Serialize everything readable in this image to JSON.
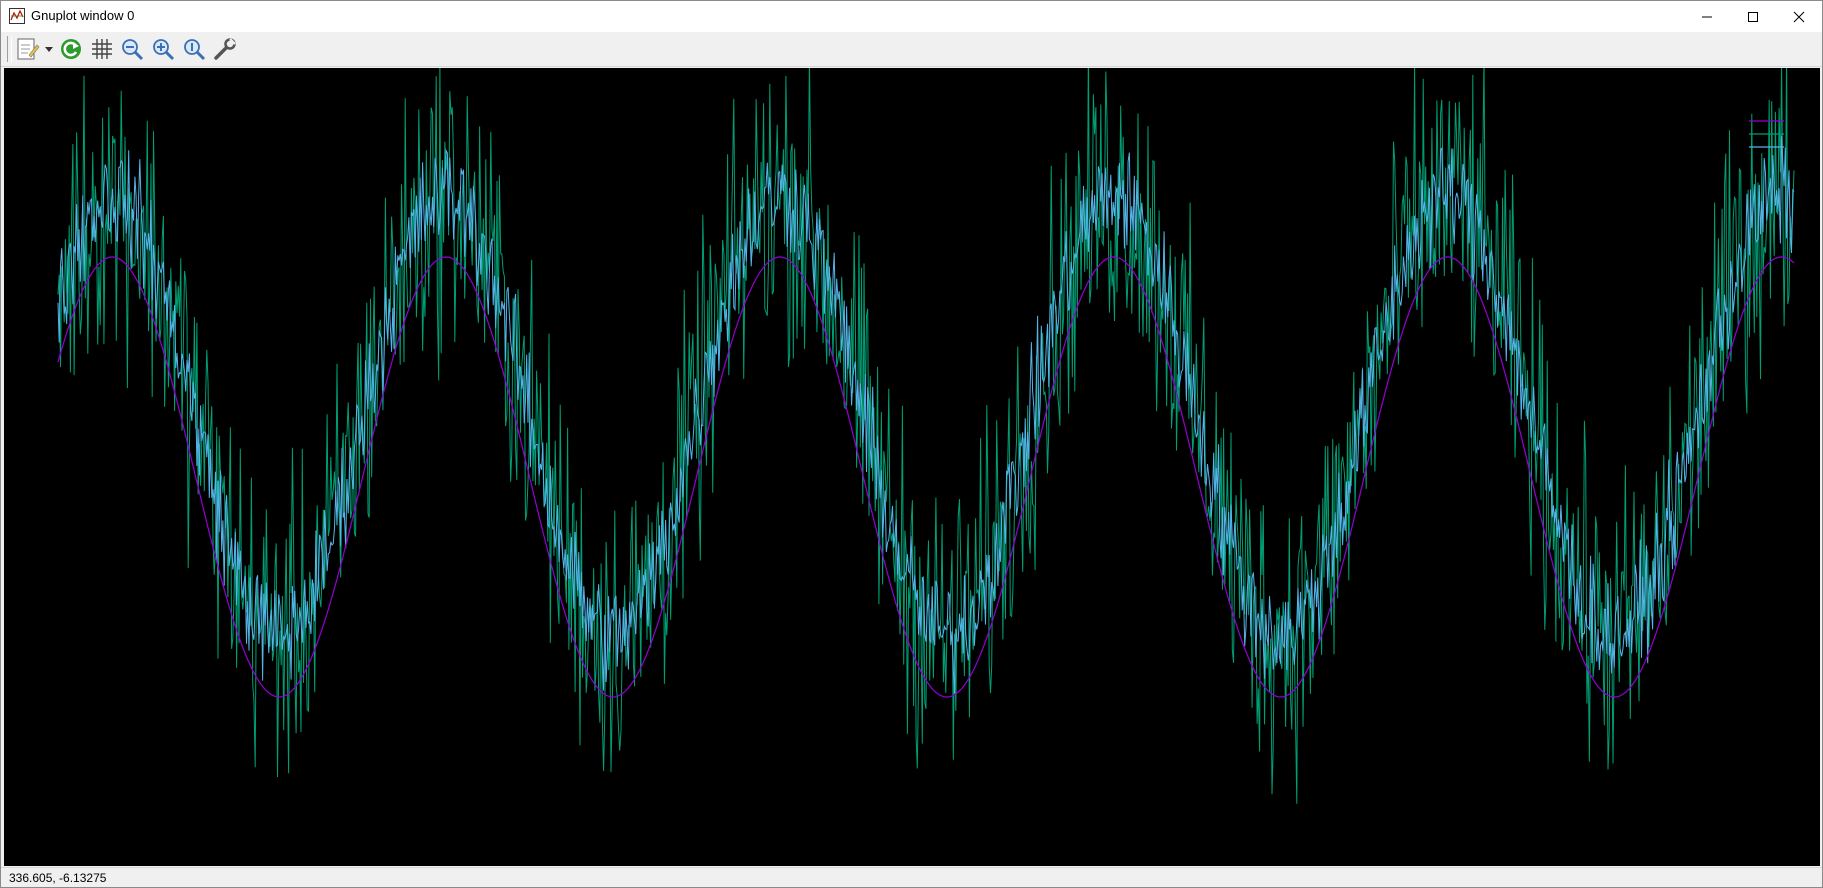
{
  "window": {
    "title": "Gnuplot window 0",
    "controls": [
      "minimize-icon",
      "maximize-icon",
      "close-icon"
    ]
  },
  "toolbar": {
    "items": [
      "copy-print-menu-icon",
      "replot-icon",
      "grid-icon",
      "zoom-out-icon",
      "zoom-in-icon",
      "zoom-reset-icon",
      "options-wrench-icon"
    ]
  },
  "status": {
    "coordinates": "336.605, -6.13275"
  },
  "chart_data": {
    "type": "line",
    "title": "",
    "xlabel": "",
    "ylabel": "",
    "background": "#000000",
    "legend_position": "top-right",
    "cycles_visible": 5.2,
    "series": [
      {
        "color": "#9400d3",
        "description": "smooth sine",
        "amplitude": 1.0,
        "noise": 0.0
      },
      {
        "color": "#009e73",
        "description": "sine plus strong noise",
        "amplitude": 1.0,
        "noise": 0.55
      },
      {
        "color": "#56b4e9",
        "description": "sine plus light noise",
        "amplitude": 1.0,
        "noise": 0.2
      }
    ]
  }
}
